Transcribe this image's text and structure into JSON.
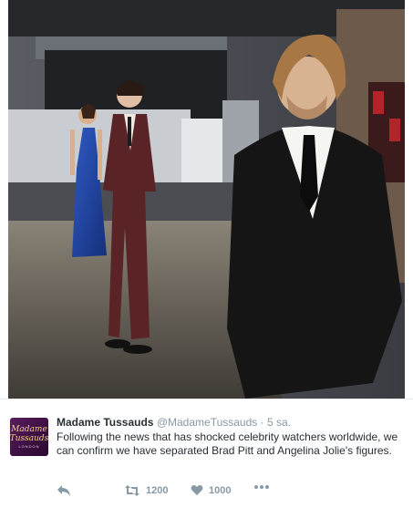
{
  "photo": {
    "alt_subject": "wax figures"
  },
  "tweet": {
    "author_name": "Madame Tussauds",
    "handle": "@MadameTussauds",
    "separator": "·",
    "timestamp": "5 sa.",
    "text": "Following the news that has shocked celebrity watchers worldwide, we can confirm we have separated Brad Pitt and Angelina Jolie's figures.",
    "avatar": {
      "line1": "Madame",
      "line2": "Tussauds",
      "line3": "LONDON"
    },
    "actions": {
      "retweet_count": "1200",
      "like_count": "1000"
    }
  },
  "colors": {
    "accent": "#8899a6",
    "text": "#292f33",
    "brand": "#4a1650"
  }
}
